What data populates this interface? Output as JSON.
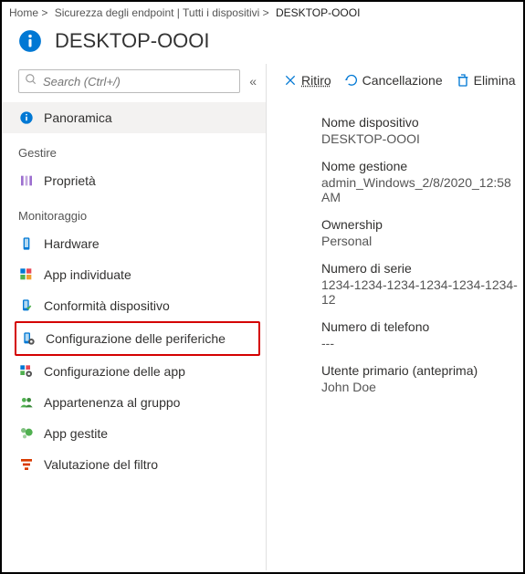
{
  "breadcrumb": {
    "home": "Home >",
    "middle": "Sicurezza degli endpoint | Tutti i dispositivi >",
    "current": "DESKTOP-OOOI"
  },
  "header": {
    "title": "DESKTOP-OOOI"
  },
  "search": {
    "placeholder": "Search (Ctrl+/)"
  },
  "nav": {
    "overview": "Panoramica",
    "manage_section": "Gestire",
    "properties": "Proprietà",
    "monitor_section": "Monitoraggio",
    "hardware": "Hardware",
    "discovered_apps": "App individuate",
    "compliance": "Conformità dispositivo",
    "device_config": "Configurazione delle periferiche",
    "app_config": "Configurazione delle app",
    "group_membership": "Appartenenza al gruppo",
    "managed_apps": "App gestite",
    "filter_eval": "Valutazione del filtro"
  },
  "actions": {
    "retire": "Ritiro",
    "wipe": "Cancellazione",
    "delete": "Elimina"
  },
  "details": {
    "device_name_label": "Nome dispositivo",
    "device_name_value": "DESKTOP-OOOI",
    "mgmt_name_label": "Nome gestione",
    "mgmt_name_value": "admin_Windows_2/8/2020_12:58 AM",
    "ownership_label": "Ownership",
    "ownership_value": "Personal",
    "serial_label": "Numero di serie",
    "serial_value": "1234-1234-1234-1234-1234-1234-12",
    "phone_label": "Numero di telefono",
    "phone_value": "---",
    "primary_user_label": "Utente primario (anteprima)",
    "primary_user_value": "John Doe"
  }
}
